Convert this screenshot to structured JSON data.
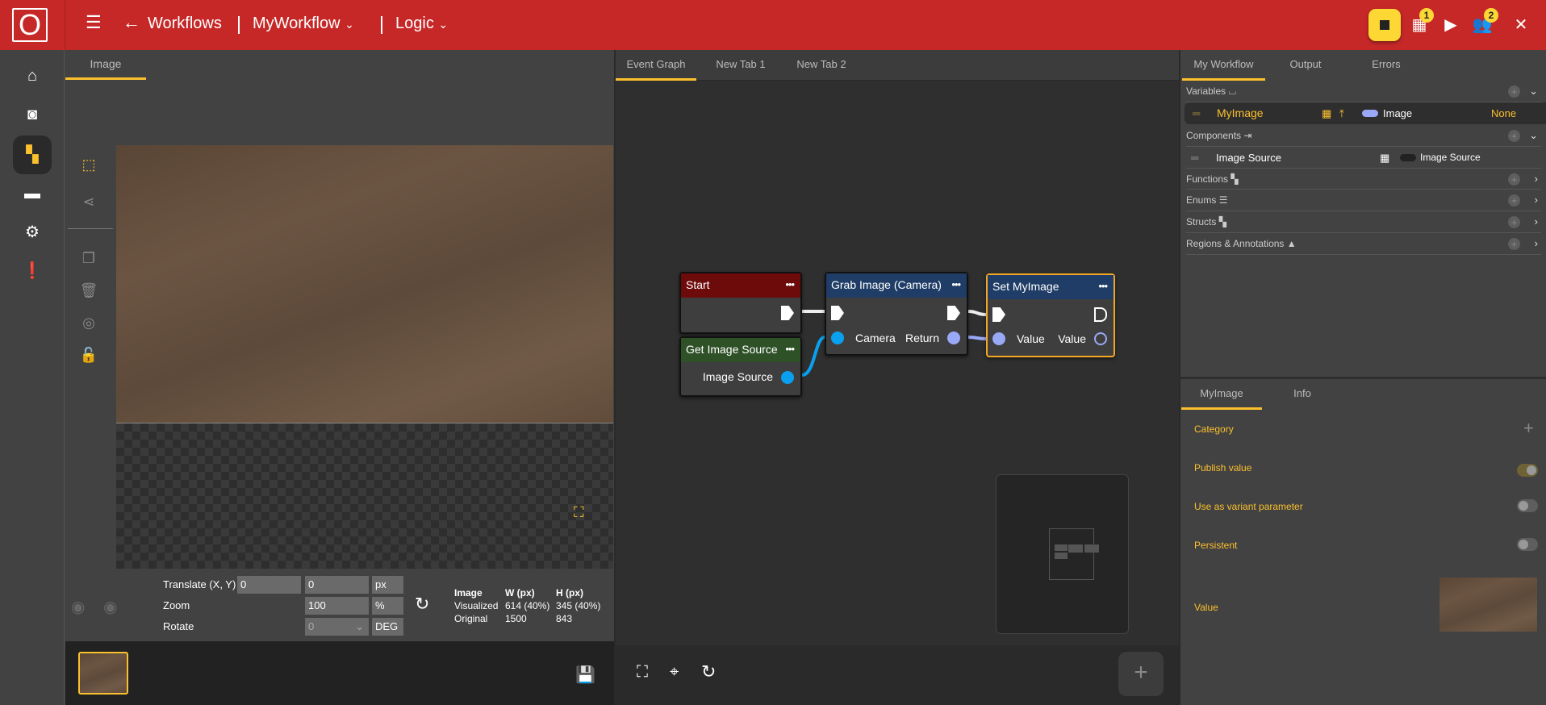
{
  "topbar": {
    "logo": "O",
    "back_label": "Workflows",
    "workflow": "MyWorkflow",
    "section": "Logic",
    "badges": [
      "1",
      "2"
    ],
    "accent": "#c62828",
    "highlight": "#fdd835"
  },
  "left": {
    "tab": "Image",
    "controls": {
      "translate_label": "Translate (X, Y)",
      "translate_x": "0",
      "translate_y": "0",
      "translate_unit": "px",
      "zoom_label": "Zoom",
      "zoom_value": "100",
      "zoom_unit": "%",
      "rotate_label": "Rotate",
      "rotate_value": "0",
      "rotate_unit": "DEG"
    },
    "info": {
      "headers": [
        "Image",
        "W (px)",
        "H (px)"
      ],
      "rows": [
        [
          "Visualized",
          "614 (40%)",
          "345 (40%)"
        ],
        [
          "Original",
          "1500",
          "843"
        ]
      ]
    }
  },
  "graph": {
    "tabs": [
      "Event Graph",
      "New Tab 1",
      "New Tab 2"
    ],
    "nodes": {
      "start": {
        "title": "Start",
        "color": "#6d0b0b"
      },
      "get_source": {
        "title": "Get Image Source",
        "out": "Image Source",
        "color": "#2e5128"
      },
      "grab": {
        "title": "Grab Image (Camera)",
        "in": "Camera",
        "out": "Return",
        "color": "#1f3d66"
      },
      "set": {
        "title": "Set MyImage",
        "in": "Value",
        "out": "Value",
        "color": "#1f3d66"
      }
    },
    "add_label": "+"
  },
  "right": {
    "tabs": [
      "My Workflow",
      "Output",
      "Errors"
    ],
    "sections": {
      "variables": "Variables",
      "components": "Components",
      "functions": "Functions",
      "enums": "Enums",
      "structs": "Structs",
      "regions": "Regions & Annotations"
    },
    "variable": {
      "name": "MyImage",
      "type": "Image",
      "value": "None"
    },
    "component": {
      "name": "Image Source",
      "type": "Image Source"
    },
    "detail_tabs": [
      "MyImage",
      "Info"
    ],
    "props": {
      "category": "Category",
      "publish": "Publish value",
      "variant": "Use as variant parameter",
      "persistent": "Persistent",
      "value": "Value"
    },
    "toggles": {
      "publish": true,
      "variant": false,
      "persistent": false
    }
  }
}
